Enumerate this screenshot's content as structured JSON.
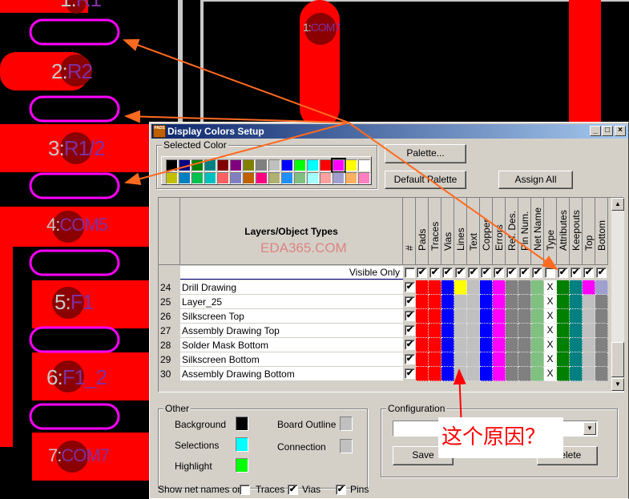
{
  "pcb": {
    "labels": [
      {
        "num": "1:",
        "name": "R1"
      },
      {
        "num": "2:",
        "name": "R2"
      },
      {
        "num": "3:",
        "name": "R1/2"
      },
      {
        "num": "4:",
        "name": "COM5"
      },
      {
        "num": "5:",
        "name": "F1"
      },
      {
        "num": "6:",
        "name": "F1_2"
      },
      {
        "num": "7:",
        "name": "COM7"
      }
    ],
    "right_label": {
      "num": "1:",
      "name": "COM7"
    }
  },
  "dialog": {
    "title": "Display Colors Setup",
    "logo_text": "PADS",
    "selected_color_label": "Selected Color",
    "palette_row1": [
      "#000000",
      "#000080",
      "#008000",
      "#008080",
      "#800000",
      "#800080",
      "#808000",
      "#808080",
      "#c0c0c0",
      "#0000ff",
      "#00ff00",
      "#00ffff",
      "#ff0000",
      "#ff00ff",
      "#ffff00",
      "#ffffff"
    ],
    "palette_row2": [
      "#c0c000",
      "#0080c0",
      "#00c050",
      "#00c0c0",
      "#ff6060",
      "#8080c0",
      "#c06000",
      "#ff0080",
      "#b0b070",
      "#2090ff",
      "#80c080",
      "#a0ffff",
      "#ffa0a0",
      "#a0a0d0",
      "#ffb060",
      "#ff80c0"
    ],
    "selected_index": 13,
    "buttons": {
      "palette": "Palette...",
      "default_palette": "Default Palette",
      "assign_all": "Assign All",
      "save": "Save",
      "delete": "Delete"
    },
    "grid": {
      "header_title": "Layers/Object Types",
      "hash_label": "#",
      "columns": [
        "Pads",
        "Traces",
        "Vias",
        "Lines",
        "Text",
        "Copper",
        "Errors",
        "Ref. Des.",
        "Pin Num.",
        "Net Name",
        "Type",
        "Attributes",
        "Keepouts",
        "Top",
        "Bottom"
      ],
      "visible_only_label": "Visible Only",
      "visible_only_hash": false,
      "visible_only": [
        true,
        true,
        true,
        true,
        true,
        true,
        true,
        true,
        true,
        true,
        false,
        true,
        true,
        true,
        true
      ],
      "rows": [
        {
          "num": "24",
          "name": "Drill Drawing",
          "visible": true,
          "colors": [
            "#ff0000",
            "#ff0000",
            "#0000ff",
            "#ffff00",
            "#c0c0c0",
            "#0000ff",
            "#ff00ff",
            "#808080",
            "#808080",
            "#80c080",
            "X",
            "#008000",
            "#008080",
            "#ff00ff",
            "#a0a0d0"
          ]
        },
        {
          "num": "25",
          "name": "Layer_25",
          "visible": true,
          "colors": [
            "#ff0000",
            "#ff0000",
            "#0000ff",
            "#c0c0c0",
            "#c0c0c0",
            "#0000ff",
            "#ff00ff",
            "#808080",
            "#808080",
            "#80c080",
            "X",
            "#008000",
            "#008080",
            "#c0c0c0",
            "#808080"
          ]
        },
        {
          "num": "26",
          "name": "Silkscreen Top",
          "visible": true,
          "colors": [
            "#ff0000",
            "#ff0000",
            "#0000ff",
            "#c0c0c0",
            "#c0c0c0",
            "#0000ff",
            "#ff00ff",
            "#808080",
            "#808080",
            "#80c080",
            "X",
            "#008000",
            "#008080",
            "#c0c0c0",
            "#808080"
          ]
        },
        {
          "num": "27",
          "name": "Assembly Drawing Top",
          "visible": true,
          "colors": [
            "#ff0000",
            "#ff0000",
            "#0000ff",
            "#c0c0c0",
            "#c0c0c0",
            "#0000ff",
            "#ff00ff",
            "#808080",
            "#808080",
            "#80c080",
            "X",
            "#008000",
            "#008080",
            "#c0c0c0",
            "#808080"
          ]
        },
        {
          "num": "28",
          "name": "Solder Mask Bottom",
          "visible": true,
          "colors": [
            "#ff0000",
            "#ff0000",
            "#0000ff",
            "#c0c0c0",
            "#c0c0c0",
            "#0000ff",
            "#ff00ff",
            "#808080",
            "#808080",
            "#80c080",
            "X",
            "#008000",
            "#008080",
            "#c0c0c0",
            "#808080"
          ]
        },
        {
          "num": "29",
          "name": "Silkscreen Bottom",
          "visible": true,
          "colors": [
            "#ff0000",
            "#ff0000",
            "#0000ff",
            "#c0c0c0",
            "#c0c0c0",
            "#0000ff",
            "#ff00ff",
            "#808080",
            "#808080",
            "#80c080",
            "X",
            "#008000",
            "#008080",
            "#c0c0c0",
            "#808080"
          ]
        },
        {
          "num": "30",
          "name": "Assembly Drawing Bottom",
          "visible": true,
          "colors": [
            "#ff0000",
            "#ff0000",
            "#0000ff",
            "#c0c0c0",
            "#c0c0c0",
            "#0000ff",
            "#ff00ff",
            "#808080",
            "#808080",
            "#80c080",
            "X",
            "#008000",
            "#008080",
            "#c0c0c0",
            "#808080"
          ]
        }
      ]
    },
    "other": {
      "label": "Other",
      "background": {
        "label": "Background",
        "color": "#000000"
      },
      "selections": {
        "label": "Selections",
        "color": "#00ffff"
      },
      "highlight": {
        "label": "Highlight",
        "color": "#00ff00"
      },
      "board_outline": {
        "label": "Board Outline",
        "color": "#c0c0c0"
      },
      "connection": {
        "label": "Connection",
        "color": "#c0c0c0"
      }
    },
    "configuration": {
      "label": "Configuration",
      "value": ""
    },
    "net_names": {
      "label": "Show net names on",
      "traces": {
        "label": "Traces",
        "checked": false
      },
      "vias": {
        "label": "Vias",
        "checked": true
      },
      "pins": {
        "label": "Pins",
        "checked": true
      }
    }
  },
  "watermark": "EDA365.COM",
  "annotation": "这个原因？"
}
